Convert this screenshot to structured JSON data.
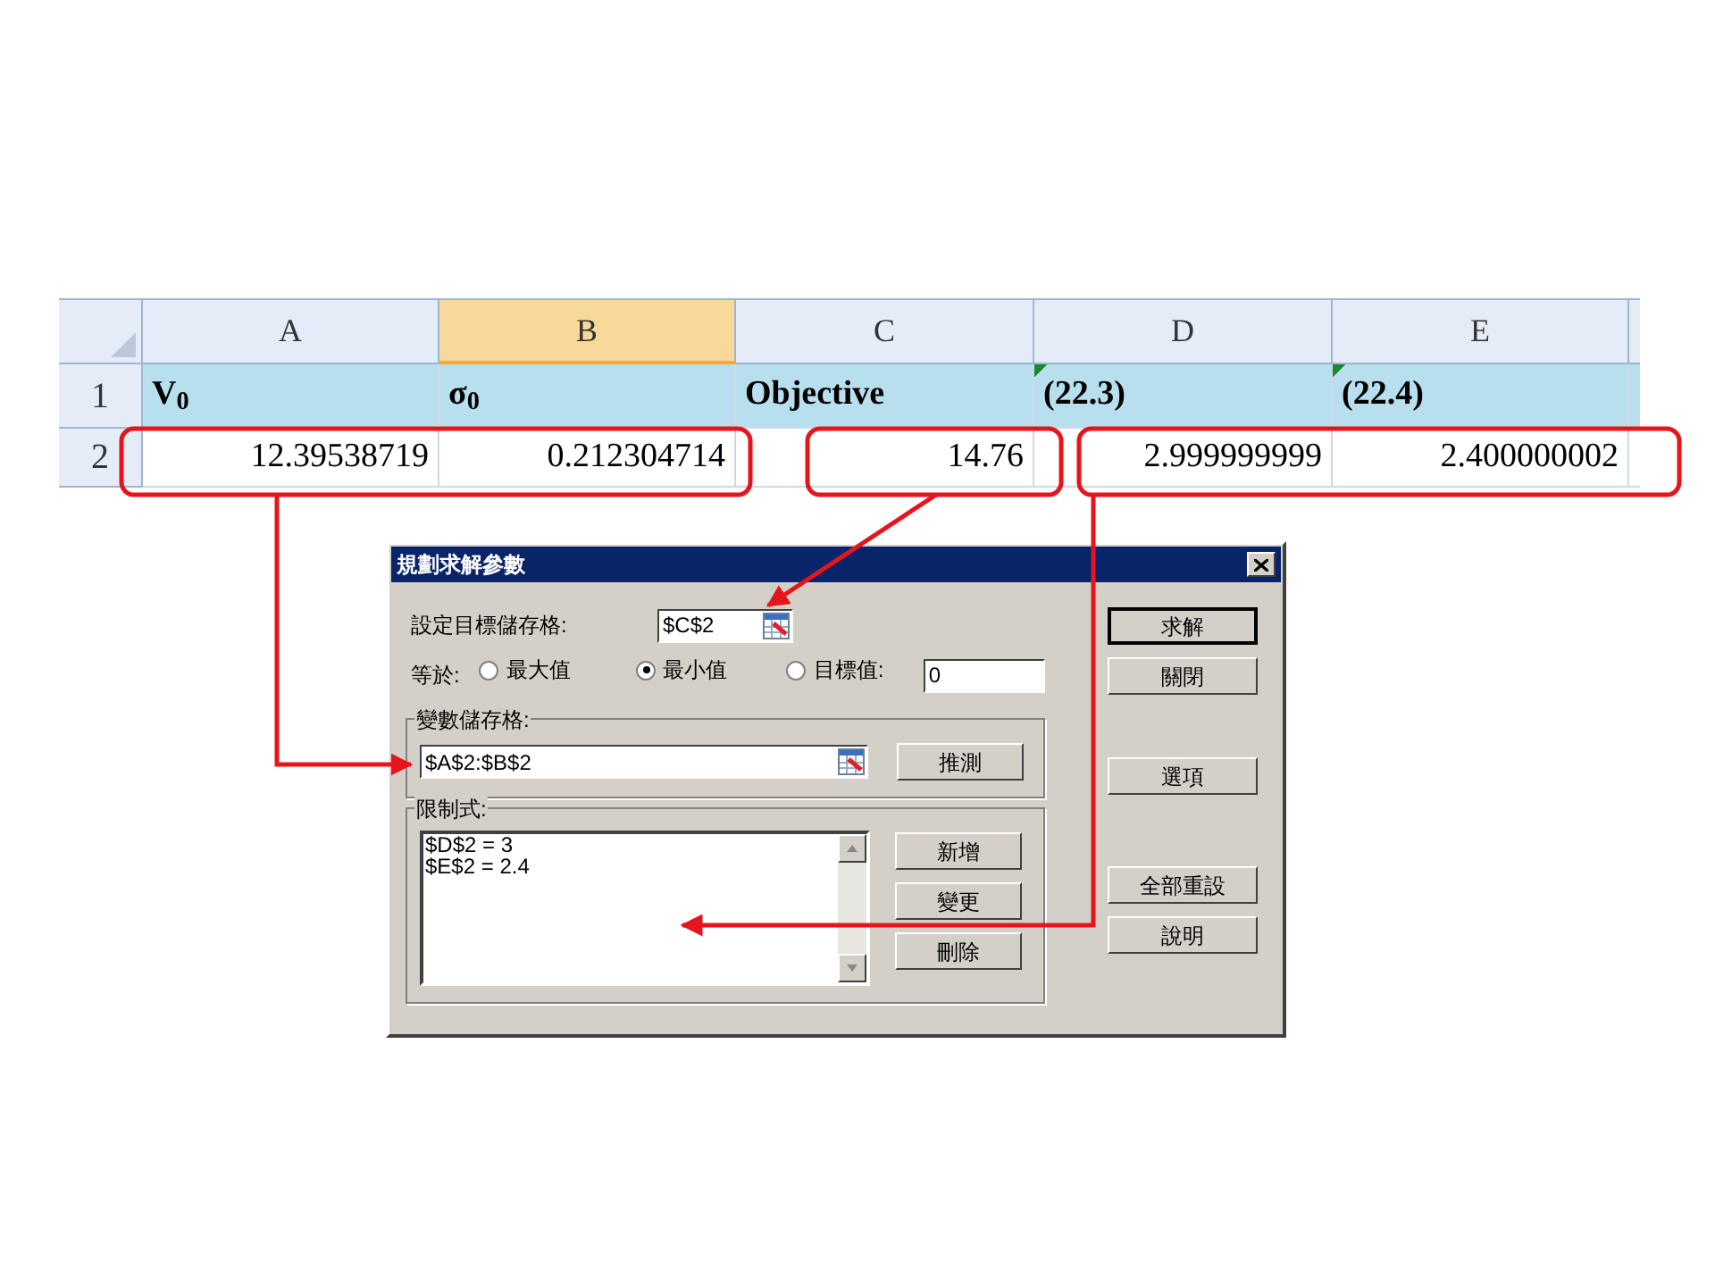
{
  "spreadsheet": {
    "columns": [
      {
        "label": "A",
        "selected": false
      },
      {
        "label": "B",
        "selected": true
      },
      {
        "label": "C",
        "selected": false
      },
      {
        "label": "D",
        "selected": false
      },
      {
        "label": "E",
        "selected": false
      }
    ],
    "rows": [
      {
        "number": "1",
        "cells": [
          {
            "text": "V$_{0}$",
            "error_marker": false
          },
          {
            "text": "σ$_{0}$",
            "error_marker": false
          },
          {
            "text": "Objective",
            "error_marker": false
          },
          {
            "text": "(22.3)",
            "error_marker": true
          },
          {
            "text": "(22.4)",
            "error_marker": true
          }
        ]
      },
      {
        "number": "2",
        "cells": [
          {
            "text": "12.39538719",
            "error_marker": false
          },
          {
            "text": "0.212304714",
            "error_marker": false
          },
          {
            "text": "14.76",
            "error_marker": false
          },
          {
            "text": "2.999999999",
            "error_marker": false
          },
          {
            "text": "2.400000002",
            "error_marker": false
          }
        ]
      }
    ]
  },
  "dialog": {
    "title": "規劃求解參數",
    "target_label": "設定目標儲存格:",
    "target_cell": "$C$2",
    "equal_label": "等於:",
    "radios": [
      {
        "label": "最大值",
        "selected": false
      },
      {
        "label": "最小值",
        "selected": true
      },
      {
        "label": "目標值:",
        "selected": false
      }
    ],
    "target_value": "0",
    "changing_label": "變數儲存格:",
    "changing_cells": "$A$2:$B$2",
    "guess_button": "推測",
    "constraints_label": "限制式:",
    "constraints": [
      "$D$2 = 3",
      "$E$2 = 2.4"
    ],
    "constraint_buttons": [
      "新增",
      "變更",
      "刪除"
    ],
    "side_buttons": [
      {
        "label": "求解",
        "default": true
      },
      {
        "label": "關閉",
        "default": false
      },
      {
        "label": "選項",
        "default": false
      },
      {
        "label": "全部重設",
        "default": false
      },
      {
        "label": "說明",
        "default": false
      }
    ]
  }
}
